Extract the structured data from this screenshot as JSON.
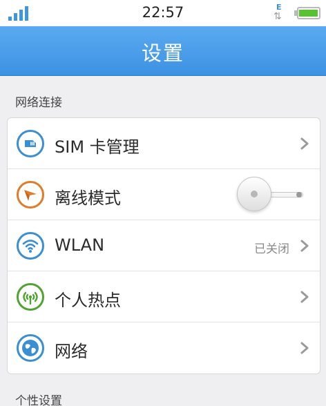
{
  "status_bar": {
    "time": "22:57",
    "network_letter": "E",
    "network_arrows": "⇅",
    "signal_strength": 4,
    "battery_level": 0.9,
    "battery_color": "#58c232"
  },
  "header": {
    "title": "设置",
    "background_color": "#4a9de8"
  },
  "sections": [
    {
      "title": "网络连接",
      "items": [
        {
          "label": "SIM 卡管理",
          "icon": "sim-card-icon",
          "icon_color": "#3a8fd2",
          "control": "chevron"
        },
        {
          "label": "离线模式",
          "icon": "paper-plane-icon",
          "icon_color": "#e07b2a",
          "control": "toggle",
          "toggle_on": false
        },
        {
          "label": "WLAN",
          "icon": "wifi-icon",
          "icon_color": "#3a8fd2",
          "control": "chevron",
          "value": "已关闭"
        },
        {
          "label": "个人热点",
          "icon": "hotspot-icon",
          "icon_color": "#4da42f",
          "control": "chevron"
        },
        {
          "label": "网络",
          "icon": "globe-icon",
          "icon_color": "#3a8fd2",
          "control": "chevron"
        }
      ]
    },
    {
      "title": "个性设置",
      "items": []
    }
  ]
}
